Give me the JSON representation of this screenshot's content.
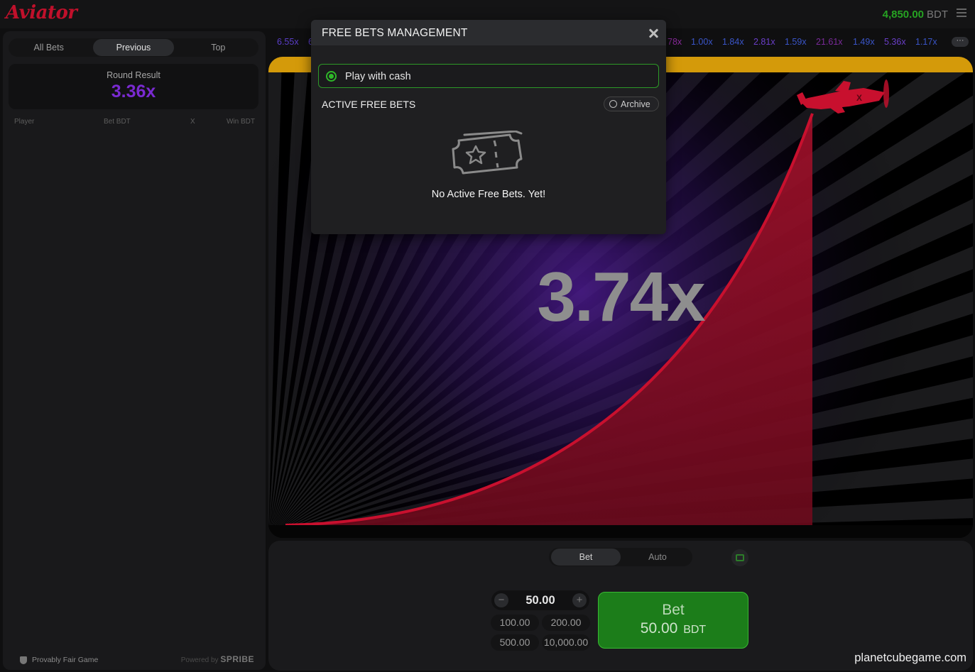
{
  "header": {
    "logo": "Aviator",
    "balance": "4,850.00",
    "currency": "BDT"
  },
  "left_panel": {
    "tabs": [
      "All Bets",
      "Previous",
      "Top"
    ],
    "active_tab": "Previous",
    "round_result_label": "Round Result",
    "round_result_value": "3.36x",
    "columns": [
      "Player",
      "Bet BDT",
      "X",
      "Win BDT"
    ],
    "footer": {
      "fair_label": "Provably Fair Game",
      "powered_prefix": "Powered by",
      "powered_brand": "SPRIBE"
    }
  },
  "history": [
    {
      "value": "6.55x",
      "color": "#5a3ec8"
    },
    {
      "value": "6",
      "color": "#5a3ec8"
    },
    {
      "value": "78x",
      "color": "#8a2b9c"
    },
    {
      "value": "1.00x",
      "color": "#3a55c8"
    },
    {
      "value": "1.84x",
      "color": "#3a55c8"
    },
    {
      "value": "2.81x",
      "color": "#6a3ec8"
    },
    {
      "value": "1.59x",
      "color": "#3a55c8"
    },
    {
      "value": "21.61x",
      "color": "#7a2a9a"
    },
    {
      "value": "1.49x",
      "color": "#3a55c8"
    },
    {
      "value": "5.36x",
      "color": "#6a3ec8"
    },
    {
      "value": "1.17x",
      "color": "#3a55c8"
    }
  ],
  "game": {
    "multiplier": "3.74x",
    "colors": {
      "plane": "#c8102e",
      "curve": "#c8102e",
      "top_bar": "#d49a0a"
    }
  },
  "controls": {
    "mode_tabs": [
      "Bet",
      "Auto"
    ],
    "active_mode": "Bet",
    "amount": "50.00",
    "minus": "−",
    "plus": "+",
    "quick_amounts": [
      "100.00",
      "200.00",
      "500.00",
      "10,000.00"
    ],
    "bet_button": {
      "label": "Bet",
      "amount": "50.00",
      "currency": "BDT"
    }
  },
  "modal": {
    "title": "FREE BETS MANAGEMENT",
    "cash_option": "Play with cash",
    "active_title": "ACTIVE FREE BETS",
    "archive_label": "Archive",
    "empty_text": "No Active Free Bets. Yet!"
  },
  "watermark": "planetcubegame.com"
}
